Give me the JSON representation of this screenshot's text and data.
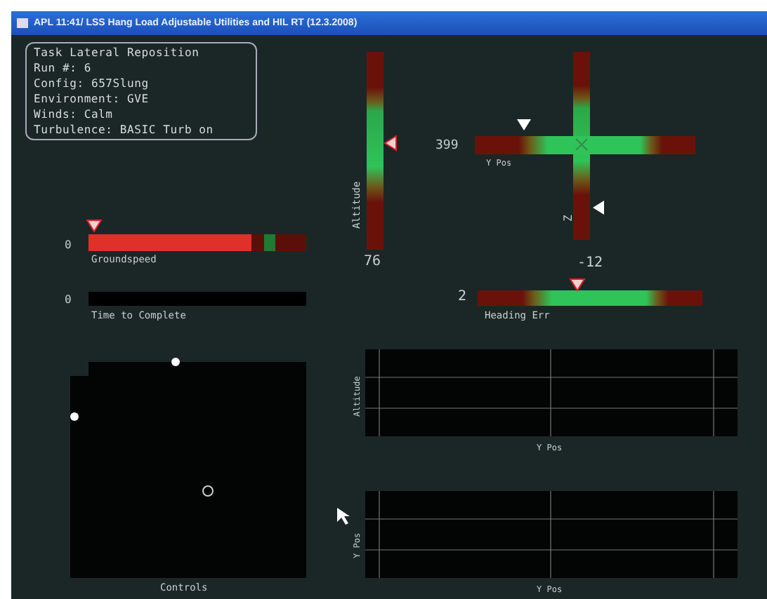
{
  "window": {
    "title": "APL 11:41/ LSS Hang Load Adjustable Utilities and HIL RT (12.3.2008)"
  },
  "info_panel": [
    {
      "label": "Task",
      "value": "Lateral Reposition"
    },
    {
      "label": "Run #:",
      "value": "6"
    },
    {
      "label": "Config:",
      "value": "657Slung"
    },
    {
      "label": "Environment:",
      "value": "GVE"
    },
    {
      "label": "Winds:",
      "value": "Calm"
    },
    {
      "label": "Turbulence:",
      "value": "BASIC Turb on"
    }
  ],
  "altitude_gauge": {
    "label": "Altitude",
    "reading": "76"
  },
  "position_cross": {
    "horizontal_label": "Y Pos",
    "horizontal_reading": "399",
    "vertical_label": "Z",
    "vertical_reading": "-12"
  },
  "groundspeed_bar": {
    "label": "Groundspeed",
    "reading": "0",
    "level": 0.75
  },
  "time_bar": {
    "label": "Time to Complete",
    "reading": "0"
  },
  "heading_bar": {
    "label": "Heading Err",
    "reading": "2"
  },
  "controls_panel": {
    "label": "Controls"
  },
  "plots": [
    {
      "ylabel": "Altitude",
      "xlabel": "Y Pos"
    },
    {
      "ylabel": "Y Pos",
      "xlabel": "Y Pos"
    }
  ]
}
